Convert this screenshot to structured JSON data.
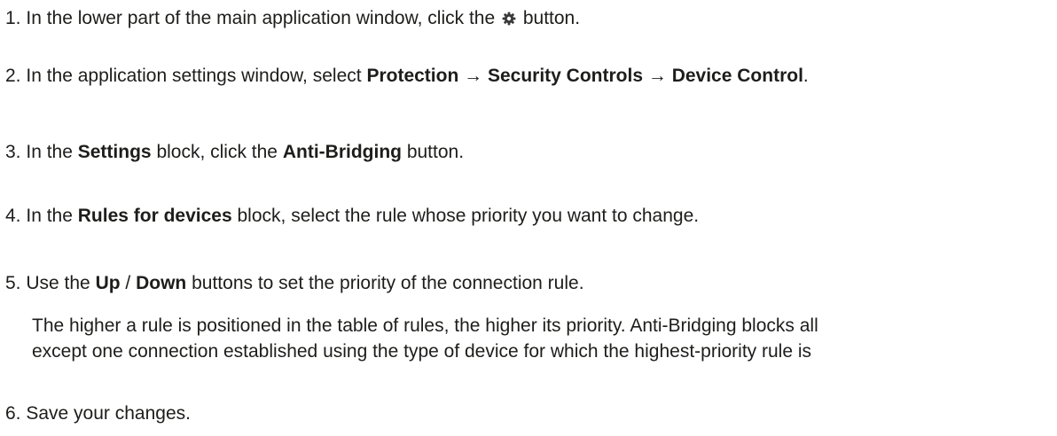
{
  "steps": [
    {
      "number": "1.",
      "text_before": "In the lower part of the main application window, click the",
      "icon": "gear-icon",
      "text_after": "button."
    },
    {
      "number": "2.",
      "text_before": "In the application settings window, select",
      "item1": "Protection",
      "arrow1": "→",
      "item2": "Security Controls",
      "arrow2": "→",
      "item3": "Device Control",
      "text_after": "."
    },
    {
      "number": "3.",
      "text_before": "In the",
      "bold1": "Settings",
      "text_middle": "block, click the",
      "bold2": "Anti-Bridging",
      "text_after": "button."
    },
    {
      "number": "4.",
      "text_before": "In the",
      "bold1": "Rules for devices",
      "text_after": "block, select the rule whose priority you want to change."
    },
    {
      "number": "5.",
      "text_before": "Use the",
      "bold1": "Up",
      "separator": "/",
      "bold2": "Down",
      "text_after": "buttons to set the priority of the connection rule.",
      "note_line1": "The higher a rule is positioned in the table of rules, the higher its priority. Anti-Bridging blocks all",
      "note_line2": "except one connection established using the type of device for which the highest-priority rule is"
    },
    {
      "number": "6.",
      "text": "Save your changes."
    }
  ]
}
